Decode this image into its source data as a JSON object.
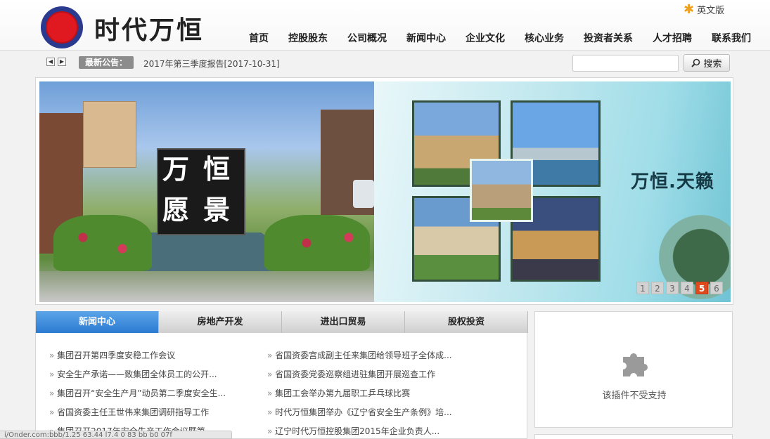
{
  "header": {
    "logo_text": "时代万恒",
    "lang_link": "英文版",
    "nav": [
      "首页",
      "控股股东",
      "公司概况",
      "新闻中心",
      "企业文化",
      "核心业务",
      "投资者关系",
      "人才招聘",
      "联系我们"
    ]
  },
  "notice": {
    "label": "最新公告：",
    "text": "2017年第三季度报告[2017-10-31]",
    "prev_icon": "◀",
    "next_icon": "▶"
  },
  "search": {
    "placeholder": "",
    "button_label": "搜索"
  },
  "banner": {
    "sign_chars": [
      "万",
      "恒",
      "愿",
      "景"
    ],
    "slogan": "万恒.天籁",
    "pages": [
      "1",
      "2",
      "3",
      "4",
      "5",
      "6"
    ],
    "active_page": "5"
  },
  "news": {
    "tabs": [
      "新闻中心",
      "房地产开发",
      "进出口贸易",
      "股权投资"
    ],
    "left": [
      "集团召开第四季度安稳工作会议",
      "安全生产承诺——致集团全体员工的公开...",
      "集团召开“安全生产月”动员第二季度安全生...",
      "省国资委主任王世伟来集团调研指导工作",
      "集团召开2017年安全生产工作会议暨第一..."
    ],
    "right": [
      "省国资委宫成副主任来集团给领导班子全体成...",
      "省国资委党委巡察组进驻集团开展巡查工作",
      "集团工会举办第九届职工乒乓球比赛",
      "时代万恒集团举办《辽宁省安全生产条例》培...",
      "辽宁时代万恒控股集团2015年企业负责人..."
    ]
  },
  "plugin": {
    "message": "该插件不受支持",
    "icon": "puzzle-icon"
  },
  "status_bar": "i/Onder.com:bbb/1.25 63.44 l7.4 0 83 bb b0 07f"
}
